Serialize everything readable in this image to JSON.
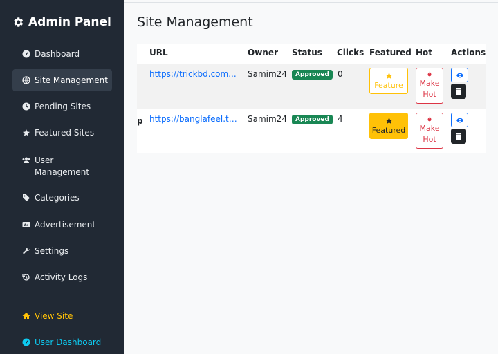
{
  "sidebar": {
    "brand": "Admin Panel",
    "items": [
      {
        "label": "Dashboard",
        "icon": "gauge-icon"
      },
      {
        "label": "Site Management",
        "icon": "globe-icon",
        "active": true
      },
      {
        "label": "Pending Sites",
        "icon": "clock-icon"
      },
      {
        "label": "Featured Sites",
        "icon": "star-icon"
      },
      {
        "label": "User Management",
        "icon": "users-icon"
      },
      {
        "label": "Categories",
        "icon": "tags-icon"
      },
      {
        "label": "Advertisement",
        "icon": "ad-icon"
      },
      {
        "label": "Settings",
        "icon": "wrench-icon"
      },
      {
        "label": "Activity Logs",
        "icon": "history-icon"
      }
    ],
    "view_site": "View Site",
    "user_dashboard": "User Dashboard"
  },
  "main": {
    "title": "Site Management",
    "columns": [
      "URL",
      "Owner",
      "Status",
      "Clicks",
      "Featured",
      "Hot",
      "Actions"
    ],
    "rows": [
      {
        "name_fragment": "",
        "url": "https://trickbd.com...",
        "owner": "Samim24",
        "status": "Approved",
        "clicks": "0",
        "featured_label": "Feature",
        "hot_label_1": "Make",
        "hot_label_2": "Hot"
      },
      {
        "name_fragment": "p",
        "url": "https://banglafeel.top...",
        "owner": "Samim24",
        "status": "Approved",
        "clicks": "4",
        "featured_label": "Featured",
        "hot_label_1": "Make",
        "hot_label_2": "Hot"
      }
    ]
  },
  "colors": {
    "sidebar_bg": "#212934",
    "accent_success": "#198754",
    "warning": "#ffc107",
    "danger": "#dc3545",
    "primary": "#0d6efd"
  }
}
